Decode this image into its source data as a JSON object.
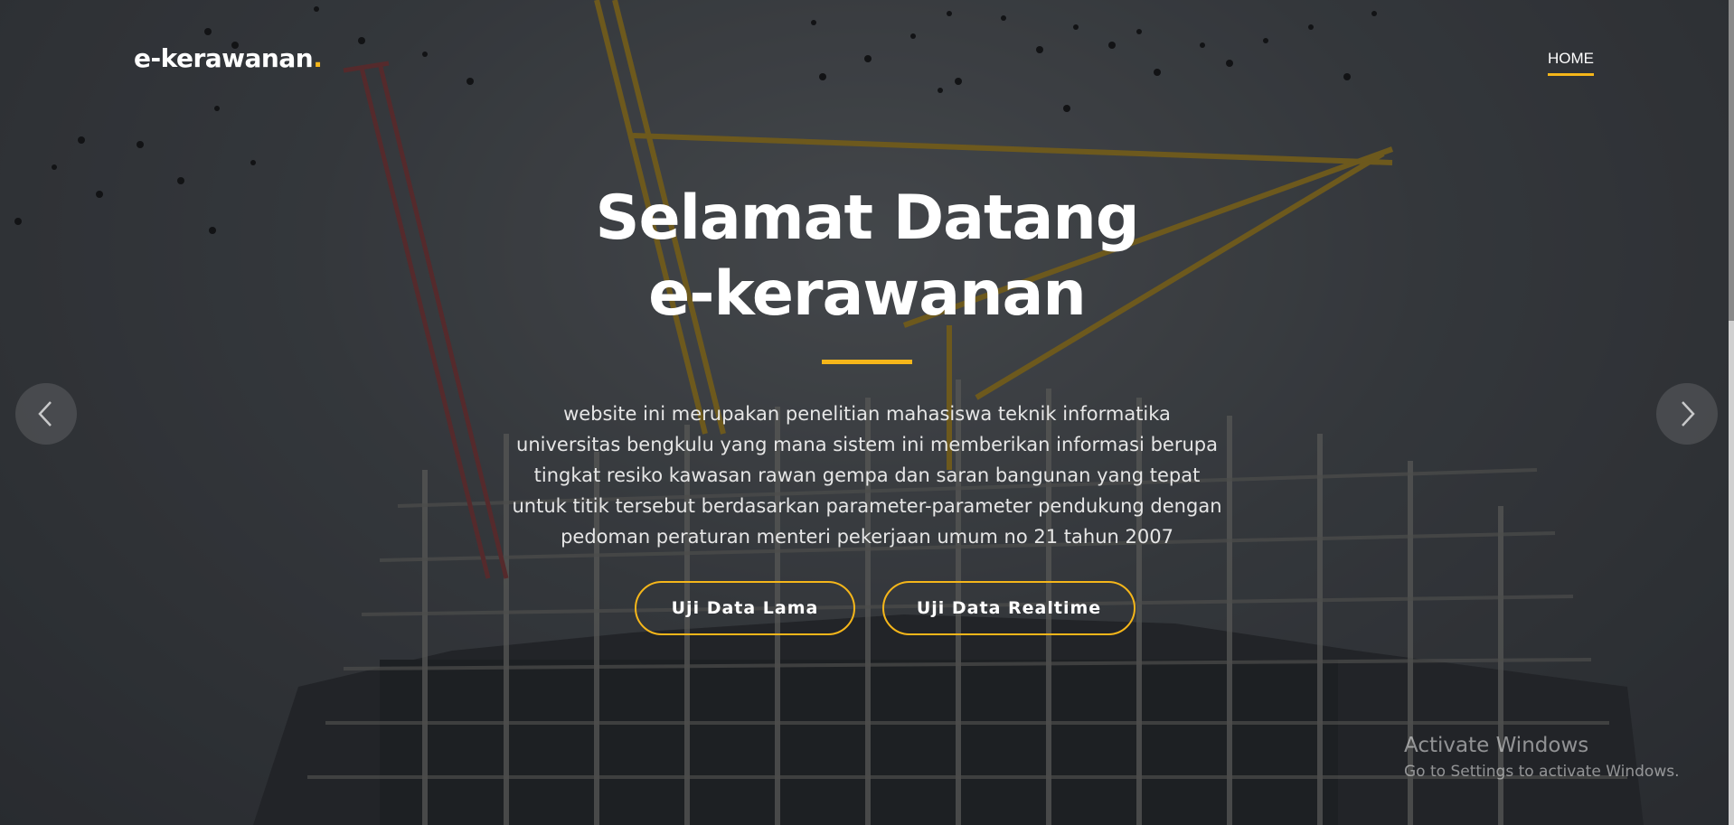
{
  "navbar": {
    "logo_text": "e-kerawanan",
    "logo_dot": ".",
    "home_label": "HOME"
  },
  "hero": {
    "title_line1": "Selamat Datang",
    "title_line2": "e-kerawanan",
    "description": "website ini merupakan penelitian mahasiswa teknik informatika universitas bengkulu yang mana sistem ini memberikan informasi berupa tingkat resiko kawasan rawan gempa dan saran bangunan yang tepat untuk titik tersebut berdasarkan parameter-parameter pendukung dengan pedoman peraturan menteri pekerjaan umum no 21 tahun 2007",
    "button_old_data": "Uji Data Lama",
    "button_realtime": "Uji Data Realtime"
  },
  "carousel": {
    "prev_icon": "chevron-left-icon",
    "next_icon": "chevron-right-icon"
  },
  "watermark": {
    "title": "Activate Windows",
    "subtitle": "Go to Settings to activate Windows."
  },
  "colors": {
    "accent": "#f5b61a",
    "text": "#ffffff",
    "overlay": "#14161a"
  }
}
